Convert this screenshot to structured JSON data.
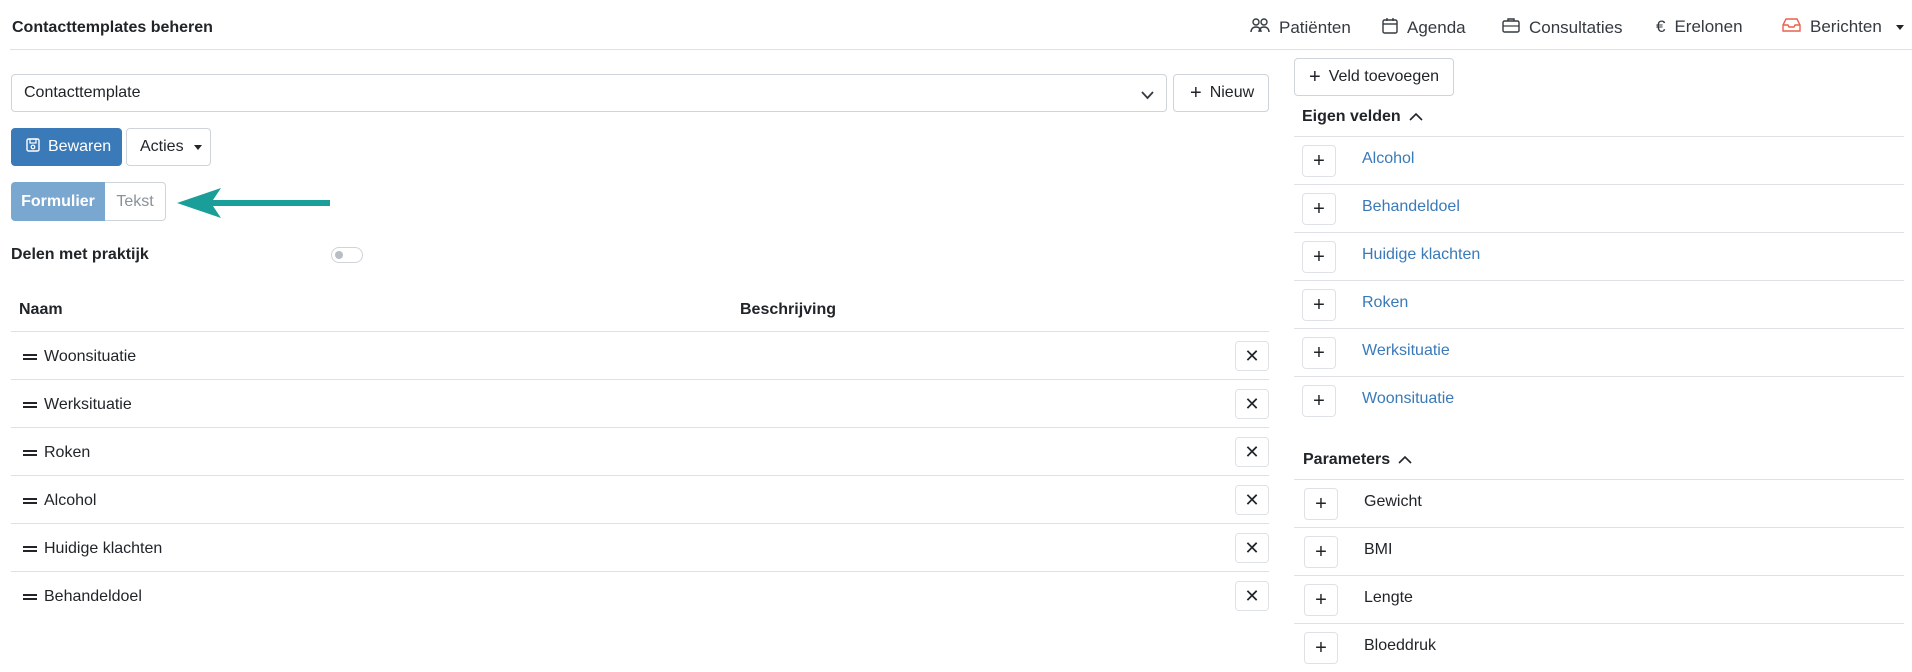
{
  "header": {
    "title": "Contacttemplates beheren",
    "nav": [
      {
        "label": "Patiënten",
        "icon": "users-icon"
      },
      {
        "label": "Agenda",
        "icon": "calendar-icon"
      },
      {
        "label": "Consultaties",
        "icon": "briefcase-icon"
      },
      {
        "label": "Erelonen",
        "icon": "euro-icon"
      },
      {
        "label": "Berichten",
        "icon": "inbox-icon"
      }
    ]
  },
  "template_select": {
    "value": "Contacttemplate"
  },
  "toolbar": {
    "new_label": "Nieuw",
    "save_label": "Bewaren",
    "actions_label": "Acties"
  },
  "view_toggle": {
    "form_label": "Formulier",
    "text_label": "Tekst",
    "selected": "Formulier"
  },
  "share": {
    "label": "Delen met praktijk",
    "enabled": false
  },
  "table": {
    "columns": [
      "Naam",
      "Beschrijving"
    ],
    "rows": [
      {
        "name": "Woonsituatie"
      },
      {
        "name": "Werksituatie"
      },
      {
        "name": "Roken"
      },
      {
        "name": "Alcohol"
      },
      {
        "name": "Huidige klachten"
      },
      {
        "name": "Behandeldoel"
      }
    ],
    "delete_symbol": "✕"
  },
  "right_panel": {
    "add_field_label": "Veld toevoegen",
    "own_fields": {
      "title": "Eigen velden",
      "items": [
        "Alcohol",
        "Behandeldoel",
        "Huidige klachten",
        "Roken",
        "Werksituatie",
        "Woonsituatie"
      ]
    },
    "parameters": {
      "title": "Parameters",
      "items": [
        "Gewicht",
        "BMI",
        "Lengte",
        "Bloeddruk"
      ]
    }
  },
  "colors": {
    "primary": "#3a7ab8",
    "segment_active": "#7aa7d0",
    "arrow": "#1a9e9a",
    "berichten_icon": "#e8624f"
  }
}
